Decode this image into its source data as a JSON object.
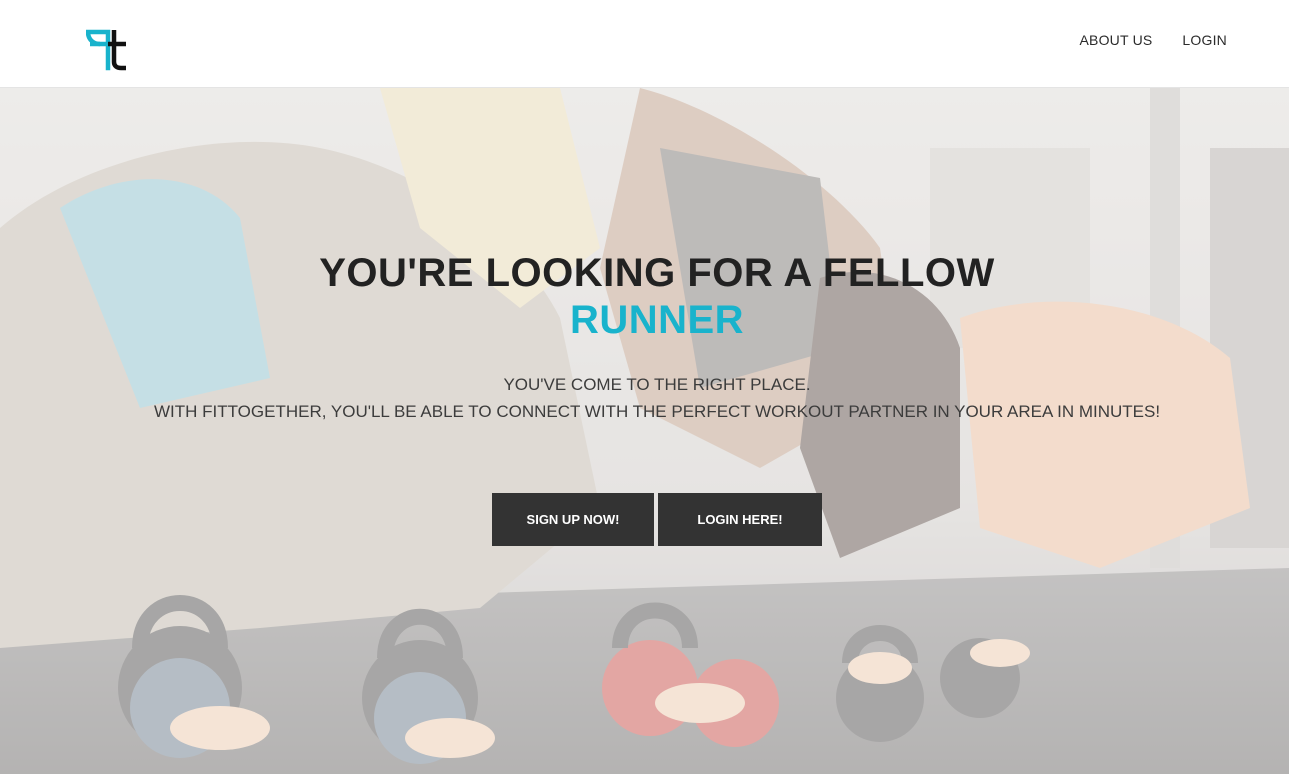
{
  "nav": {
    "about_label": "ABOUT US",
    "login_label": "LOGIN"
  },
  "hero": {
    "headline": "YOU'RE LOOKING FOR A FELLOW",
    "headline_accent": "RUNNER",
    "subline_1": "YOU'VE COME TO THE RIGHT PLACE.",
    "subline_2": "WITH FITTOGETHER, YOU'LL BE ABLE TO CONNECT WITH THE PERFECT WORKOUT PARTNER IN YOUR AREA IN MINUTES!",
    "signup_label": "SIGN UP NOW!",
    "login_label": "LOGIN HERE!"
  },
  "colors": {
    "accent": "#19b3cc",
    "button_bg": "#333333",
    "headline": "#222222"
  },
  "icons": {
    "logo": "ft-logo-icon"
  }
}
